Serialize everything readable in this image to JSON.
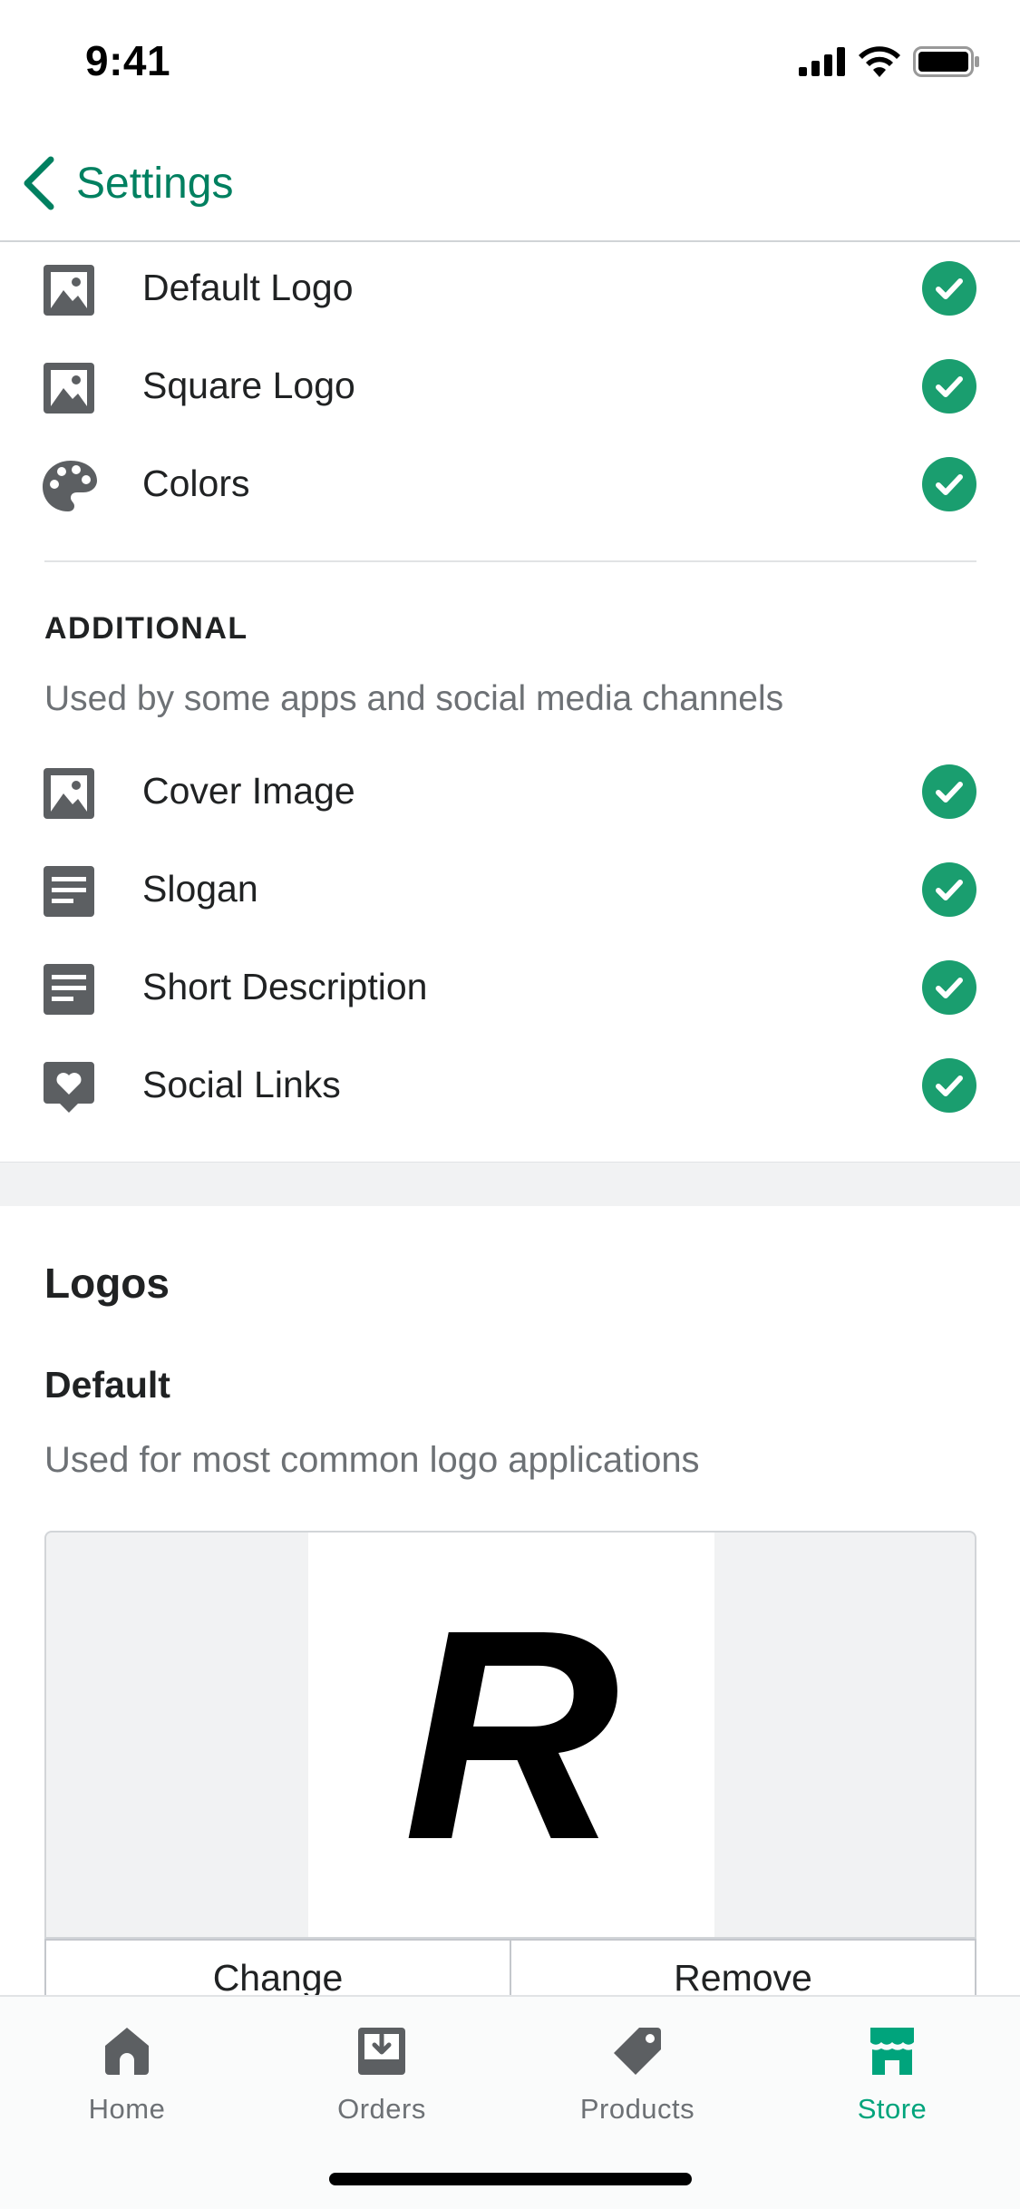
{
  "status_bar": {
    "time": "9:41"
  },
  "nav": {
    "back_label": "Settings"
  },
  "checklist": {
    "items": [
      {
        "label": "Default Logo",
        "icon": "image-icon"
      },
      {
        "label": "Square Logo",
        "icon": "image-icon"
      },
      {
        "label": "Colors",
        "icon": "palette-icon"
      }
    ],
    "additional": {
      "heading": "ADDITIONAL",
      "subtitle": "Used by some apps and social media channels",
      "items": [
        {
          "label": "Cover Image",
          "icon": "image-icon"
        },
        {
          "label": "Slogan",
          "icon": "text-icon"
        },
        {
          "label": "Short Description",
          "icon": "text-icon"
        },
        {
          "label": "Social Links",
          "icon": "heart-bubble-icon"
        }
      ]
    },
    "check_color": "#1a9e6f"
  },
  "logos": {
    "title": "Logos",
    "default_title": "Default",
    "default_subtitle": "Used for most common logo applications",
    "logo_letter": "R",
    "change_label": "Change",
    "remove_label": "Remove"
  },
  "tabs": [
    {
      "label": "Home",
      "active": false
    },
    {
      "label": "Orders",
      "active": false
    },
    {
      "label": "Products",
      "active": false
    },
    {
      "label": "Store",
      "active": true
    }
  ],
  "colors": {
    "accent": "#008060",
    "active_tab": "#00a47c",
    "icon_gray": "#5c5f62"
  }
}
